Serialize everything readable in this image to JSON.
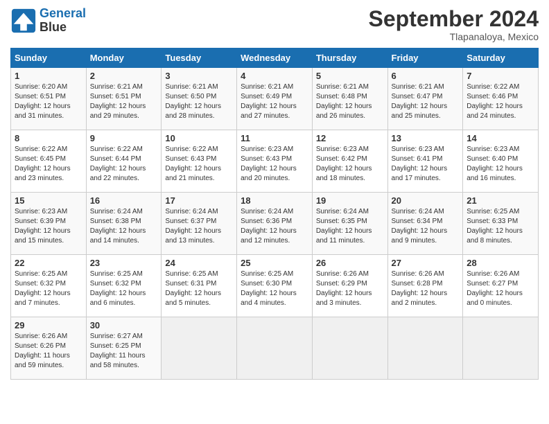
{
  "app": {
    "logo_line1": "General",
    "logo_line2": "Blue"
  },
  "calendar": {
    "month": "September 2024",
    "location": "Tlapanaloya, Mexico",
    "days_of_week": [
      "Sunday",
      "Monday",
      "Tuesday",
      "Wednesday",
      "Thursday",
      "Friday",
      "Saturday"
    ],
    "weeks": [
      [
        null,
        null,
        null,
        null,
        null,
        null,
        null
      ]
    ],
    "cells": [
      {
        "day": null,
        "week": 0,
        "col": 0
      },
      {
        "day": null,
        "week": 0,
        "col": 1
      },
      {
        "day": null,
        "week": 0,
        "col": 2
      },
      {
        "day": null,
        "week": 0,
        "col": 3
      },
      {
        "day": null,
        "week": 0,
        "col": 4
      },
      {
        "day": null,
        "week": 0,
        "col": 5
      },
      {
        "day": null,
        "week": 0,
        "col": 6
      }
    ],
    "rows": [
      [
        {
          "num": "1",
          "info": "Sunrise: 6:20 AM\nSunset: 6:51 PM\nDaylight: 12 hours\nand 31 minutes."
        },
        {
          "num": "2",
          "info": "Sunrise: 6:21 AM\nSunset: 6:51 PM\nDaylight: 12 hours\nand 29 minutes."
        },
        {
          "num": "3",
          "info": "Sunrise: 6:21 AM\nSunset: 6:50 PM\nDaylight: 12 hours\nand 28 minutes."
        },
        {
          "num": "4",
          "info": "Sunrise: 6:21 AM\nSunset: 6:49 PM\nDaylight: 12 hours\nand 27 minutes."
        },
        {
          "num": "5",
          "info": "Sunrise: 6:21 AM\nSunset: 6:48 PM\nDaylight: 12 hours\nand 26 minutes."
        },
        {
          "num": "6",
          "info": "Sunrise: 6:21 AM\nSunset: 6:47 PM\nDaylight: 12 hours\nand 25 minutes."
        },
        {
          "num": "7",
          "info": "Sunrise: 6:22 AM\nSunset: 6:46 PM\nDaylight: 12 hours\nand 24 minutes."
        }
      ],
      [
        {
          "num": "8",
          "info": "Sunrise: 6:22 AM\nSunset: 6:45 PM\nDaylight: 12 hours\nand 23 minutes."
        },
        {
          "num": "9",
          "info": "Sunrise: 6:22 AM\nSunset: 6:44 PM\nDaylight: 12 hours\nand 22 minutes."
        },
        {
          "num": "10",
          "info": "Sunrise: 6:22 AM\nSunset: 6:43 PM\nDaylight: 12 hours\nand 21 minutes."
        },
        {
          "num": "11",
          "info": "Sunrise: 6:23 AM\nSunset: 6:43 PM\nDaylight: 12 hours\nand 20 minutes."
        },
        {
          "num": "12",
          "info": "Sunrise: 6:23 AM\nSunset: 6:42 PM\nDaylight: 12 hours\nand 18 minutes."
        },
        {
          "num": "13",
          "info": "Sunrise: 6:23 AM\nSunset: 6:41 PM\nDaylight: 12 hours\nand 17 minutes."
        },
        {
          "num": "14",
          "info": "Sunrise: 6:23 AM\nSunset: 6:40 PM\nDaylight: 12 hours\nand 16 minutes."
        }
      ],
      [
        {
          "num": "15",
          "info": "Sunrise: 6:23 AM\nSunset: 6:39 PM\nDaylight: 12 hours\nand 15 minutes."
        },
        {
          "num": "16",
          "info": "Sunrise: 6:24 AM\nSunset: 6:38 PM\nDaylight: 12 hours\nand 14 minutes."
        },
        {
          "num": "17",
          "info": "Sunrise: 6:24 AM\nSunset: 6:37 PM\nDaylight: 12 hours\nand 13 minutes."
        },
        {
          "num": "18",
          "info": "Sunrise: 6:24 AM\nSunset: 6:36 PM\nDaylight: 12 hours\nand 12 minutes."
        },
        {
          "num": "19",
          "info": "Sunrise: 6:24 AM\nSunset: 6:35 PM\nDaylight: 12 hours\nand 11 minutes."
        },
        {
          "num": "20",
          "info": "Sunrise: 6:24 AM\nSunset: 6:34 PM\nDaylight: 12 hours\nand 9 minutes."
        },
        {
          "num": "21",
          "info": "Sunrise: 6:25 AM\nSunset: 6:33 PM\nDaylight: 12 hours\nand 8 minutes."
        }
      ],
      [
        {
          "num": "22",
          "info": "Sunrise: 6:25 AM\nSunset: 6:32 PM\nDaylight: 12 hours\nand 7 minutes."
        },
        {
          "num": "23",
          "info": "Sunrise: 6:25 AM\nSunset: 6:32 PM\nDaylight: 12 hours\nand 6 minutes."
        },
        {
          "num": "24",
          "info": "Sunrise: 6:25 AM\nSunset: 6:31 PM\nDaylight: 12 hours\nand 5 minutes."
        },
        {
          "num": "25",
          "info": "Sunrise: 6:25 AM\nSunset: 6:30 PM\nDaylight: 12 hours\nand 4 minutes."
        },
        {
          "num": "26",
          "info": "Sunrise: 6:26 AM\nSunset: 6:29 PM\nDaylight: 12 hours\nand 3 minutes."
        },
        {
          "num": "27",
          "info": "Sunrise: 6:26 AM\nSunset: 6:28 PM\nDaylight: 12 hours\nand 2 minutes."
        },
        {
          "num": "28",
          "info": "Sunrise: 6:26 AM\nSunset: 6:27 PM\nDaylight: 12 hours\nand 0 minutes."
        }
      ],
      [
        {
          "num": "29",
          "info": "Sunrise: 6:26 AM\nSunset: 6:26 PM\nDaylight: 11 hours\nand 59 minutes."
        },
        {
          "num": "30",
          "info": "Sunrise: 6:27 AM\nSunset: 6:25 PM\nDaylight: 11 hours\nand 58 minutes."
        },
        null,
        null,
        null,
        null,
        null
      ]
    ]
  }
}
